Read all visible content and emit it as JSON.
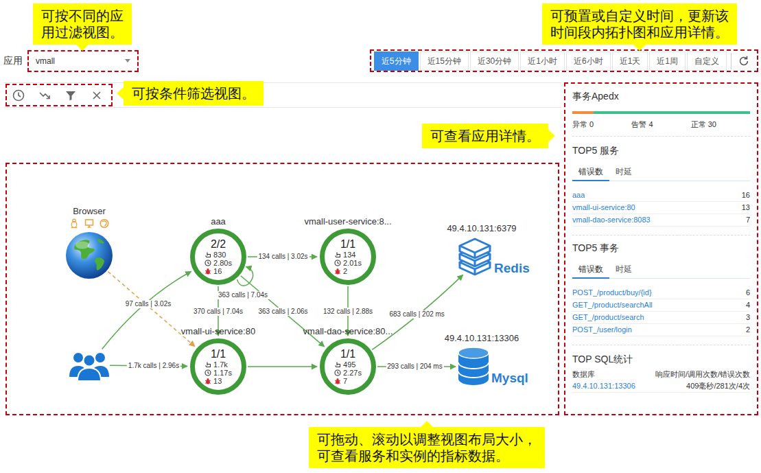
{
  "app_filter": {
    "label": "应用",
    "value": "vmall"
  },
  "time_range": [
    {
      "label": "近5分钟",
      "selected": true
    },
    {
      "label": "近15分钟",
      "selected": false
    },
    {
      "label": "近30分钟",
      "selected": false
    },
    {
      "label": "近1小时",
      "selected": false
    },
    {
      "label": "近6小时",
      "selected": false
    },
    {
      "label": "近1天",
      "selected": false
    },
    {
      "label": "近1周",
      "selected": false
    },
    {
      "label": "自定义",
      "selected": false
    }
  ],
  "topology": {
    "nodes": [
      {
        "kind": "client",
        "name": "Browser"
      },
      {
        "kind": "users"
      },
      {
        "kind": "service",
        "name": "aaa",
        "instances": "2/2",
        "calls": "830",
        "latency": "2.80s",
        "errors": "16"
      },
      {
        "kind": "service",
        "name": "vmall-user-service:8...",
        "instances": "1/1",
        "calls": "134",
        "latency": "2.01s",
        "errors": "2"
      },
      {
        "kind": "service",
        "name": "vmall-ui-service:80",
        "instances": "1/1",
        "calls": "1.7k",
        "latency": "1.17s",
        "errors": "13"
      },
      {
        "kind": "service",
        "name": "vmall-dao-service:80...",
        "instances": "1/1",
        "calls": "495",
        "latency": "2.27s",
        "errors": "7"
      },
      {
        "kind": "redis",
        "name": "49.4.10.131:6379",
        "logo": "Redis"
      },
      {
        "kind": "mysql",
        "name": "49.4.10.131:13306",
        "logo": "Mysql"
      }
    ],
    "edges": [
      {
        "from": 1,
        "to": 2,
        "kind": "call",
        "label": "97 calls | 3.02s"
      },
      {
        "from": 1,
        "to": 4,
        "kind": "call",
        "label": "1.7k calls | 2.96s"
      },
      {
        "from": 0,
        "to": 4,
        "kind": "browser"
      },
      {
        "from": 2,
        "to": 3,
        "kind": "call",
        "label": "134 calls | 3.02s"
      },
      {
        "from": 2,
        "to": 2,
        "kind": "call",
        "label": "363 calls | 7.04s"
      },
      {
        "from": 2,
        "to": 4,
        "kind": "call",
        "label": "370 calls | 7.04s"
      },
      {
        "from": 2,
        "to": 5,
        "kind": "call",
        "label": "363 calls | 2.06s"
      },
      {
        "from": 3,
        "to": 5,
        "kind": "call",
        "label": "132 calls | 2.88s"
      },
      {
        "from": 4,
        "to": 5,
        "kind": "call"
      },
      {
        "from": 5,
        "to": 6,
        "kind": "call",
        "label": "683 calls | 202 ms"
      },
      {
        "from": 5,
        "to": 7,
        "kind": "call",
        "label": "293 calls | 204 ms"
      }
    ]
  },
  "details": {
    "apdex": {
      "title": "事务Apedx",
      "segments": [
        {
          "level": 0.12,
          "color": "#f08c3a"
        },
        {
          "level": 0.88,
          "color": "#3dbf8f"
        }
      ],
      "stats": [
        "异常 0",
        "告警 4",
        "正常 30"
      ]
    },
    "top_services": {
      "title": "TOP5 服务",
      "tabs": [
        {
          "label": "错误数",
          "selected": true
        },
        {
          "label": "时延",
          "selected": false
        }
      ],
      "rows": [
        {
          "name": "aaa",
          "value": "16"
        },
        {
          "name": "vmall-ui-service:80",
          "value": "13"
        },
        {
          "name": "vmall-dao-service:8083",
          "value": "7"
        }
      ]
    },
    "top_transactions": {
      "title": "TOP5 事务",
      "tabs": [
        {
          "label": "错误数",
          "selected": true
        },
        {
          "label": "时延",
          "selected": false
        }
      ],
      "rows": [
        {
          "name": "POST_/product/buy/{id}",
          "value": "6"
        },
        {
          "name": "GET_/product/searchAll",
          "value": "4"
        },
        {
          "name": "GET_/product/search",
          "value": "3"
        },
        {
          "name": "POST_/user/login",
          "value": "2"
        }
      ]
    },
    "top_sql": {
      "title": "TOP SQL统计",
      "columns": [
        "数据库",
        "响应时间/调用次数/错误次数"
      ],
      "rows": [
        [
          "49.4.10.131:13306",
          "409毫秒/281次/4次"
        ]
      ]
    }
  },
  "callouts": [
    {
      "kind": "down",
      "lines": [
        "可按不同的应",
        "用过滤视图。"
      ]
    },
    {
      "kind": "down",
      "lines": [
        "可预置或自定义时间，更新该",
        "时间段内拓扑图和应用详情。"
      ]
    },
    {
      "kind": "left",
      "lines": [
        "可按条件筛选视图。"
      ]
    },
    {
      "kind": "right",
      "lines": [
        "可查看应用详情。"
      ]
    },
    {
      "kind": "up",
      "lines": [
        "可拖动、滚动以调整视图布局大小，",
        "可查看服务和实例的指标数据。"
      ]
    }
  ]
}
